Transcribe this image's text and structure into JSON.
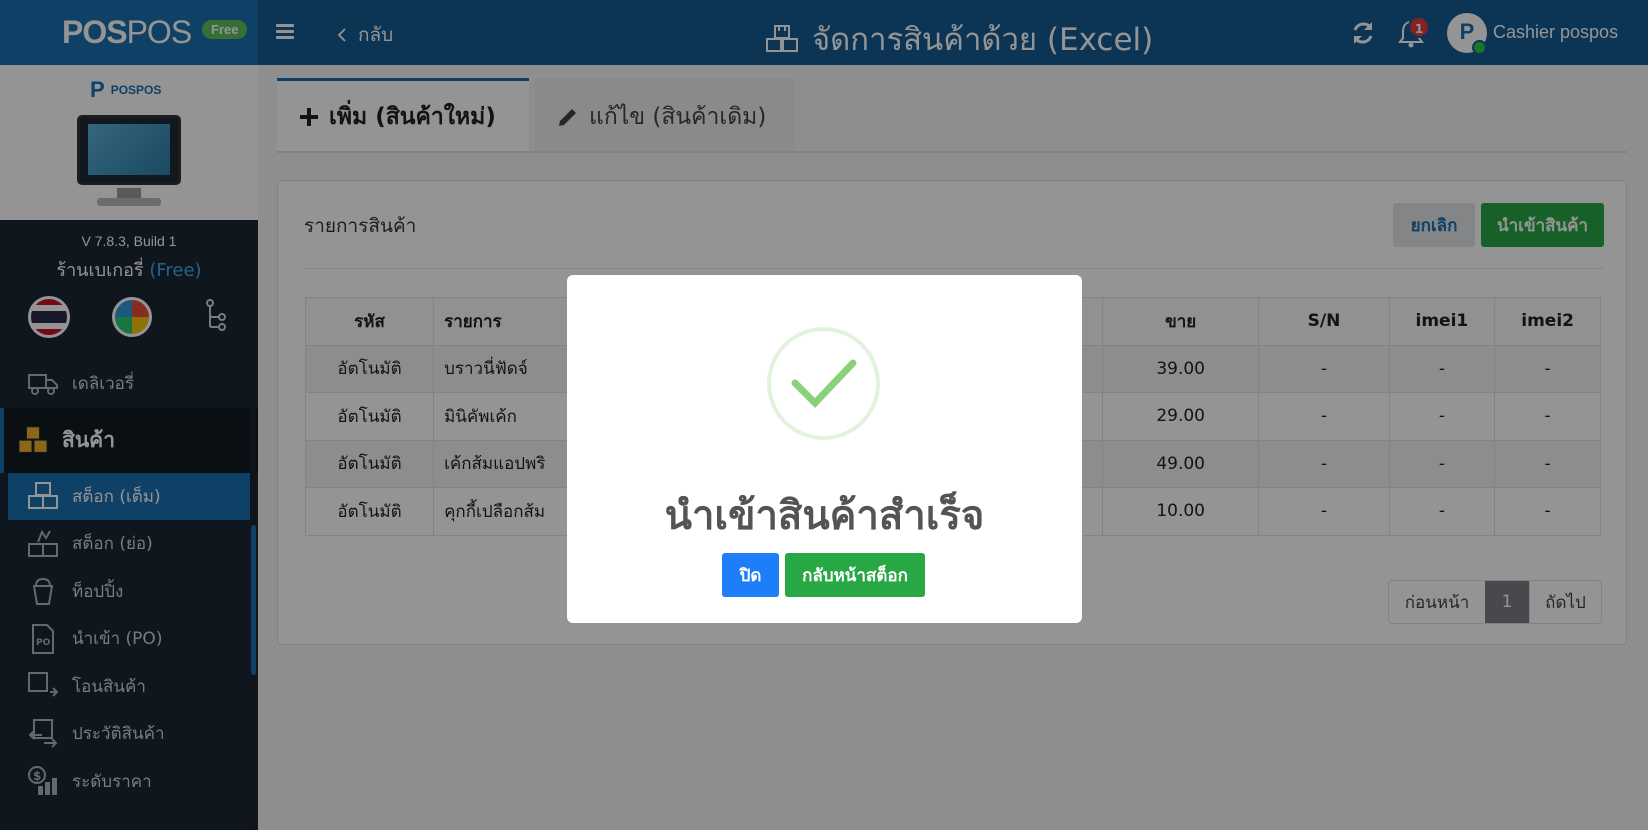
{
  "header": {
    "brand_name_bold": "POS",
    "brand_name_light": "POS",
    "brand_badge": "Free",
    "back_label": "กลับ",
    "page_title": "จัดการสินค้าด้วย (Excel)",
    "notification_count": "1",
    "avatar_letter": "P",
    "user_name": "Cashier pospos"
  },
  "sidebar": {
    "device_logo_text": "POSPOS",
    "version": "V 7.8.3, Build 1",
    "store_name": "ร้านเบเกอรี่",
    "store_tier": "(Free)",
    "items": [
      {
        "label": "เดลิเวอรี่",
        "icon": "delivery-truck-icon"
      },
      {
        "label": "สินค้า",
        "icon": "boxes-icon"
      },
      {
        "label": "สต็อก (เต็ม)",
        "icon": "stock-full-icon"
      },
      {
        "label": "สต็อก (ย่อ)",
        "icon": "stock-short-icon"
      },
      {
        "label": "ท็อปปิ้ง",
        "icon": "topping-cup-icon"
      },
      {
        "label": "นำเข้า (PO)",
        "icon": "po-document-icon"
      },
      {
        "label": "โอนสินค้า",
        "icon": "transfer-icon"
      },
      {
        "label": "ประวัติสินค้า",
        "icon": "history-icon"
      },
      {
        "label": "ระดับราคา",
        "icon": "price-level-icon"
      }
    ],
    "accent_color": "#1a6fae"
  },
  "tabs": [
    {
      "label": "เพิ่ม (สินค้าใหม่)",
      "icon": "plus-icon"
    },
    {
      "label": "แก้ไข (สินค้าเดิม)",
      "icon": "pencil-icon"
    }
  ],
  "card": {
    "title": "รายการสินค้า",
    "cancel_label": "ยกเลิก",
    "import_label": "นำเข้าสินค้า"
  },
  "table": {
    "columns": [
      "รหัส",
      "รายการ",
      "",
      "ขาย",
      "S/N",
      "imei1",
      "imei2"
    ],
    "rows": [
      [
        "อัตโนมัติ",
        "บราวนี่ฟัดจ์",
        "",
        "39.00",
        "-",
        "-",
        "-"
      ],
      [
        "อัตโนมัติ",
        "มินิคัพเค้ก",
        "",
        "29.00",
        "-",
        "-",
        "-"
      ],
      [
        "อัตโนมัติ",
        "เค้กส้มแอปพริ",
        "",
        "49.00",
        "-",
        "-",
        "-"
      ],
      [
        "อัตโนมัติ",
        "คุกกี้เปลือกส้ม",
        "",
        "10.00",
        "-",
        "-",
        "-"
      ]
    ]
  },
  "pagination": {
    "prev_label": "ก่อนหน้า",
    "current_page": "1",
    "next_label": "ถัดไป"
  },
  "modal": {
    "title": "นำเข้าสินค้าสำเร็จ",
    "close_label": "ปิด",
    "back_to_stock_label": "กลับหน้าสต็อก",
    "success_color": "#8bd17c"
  }
}
